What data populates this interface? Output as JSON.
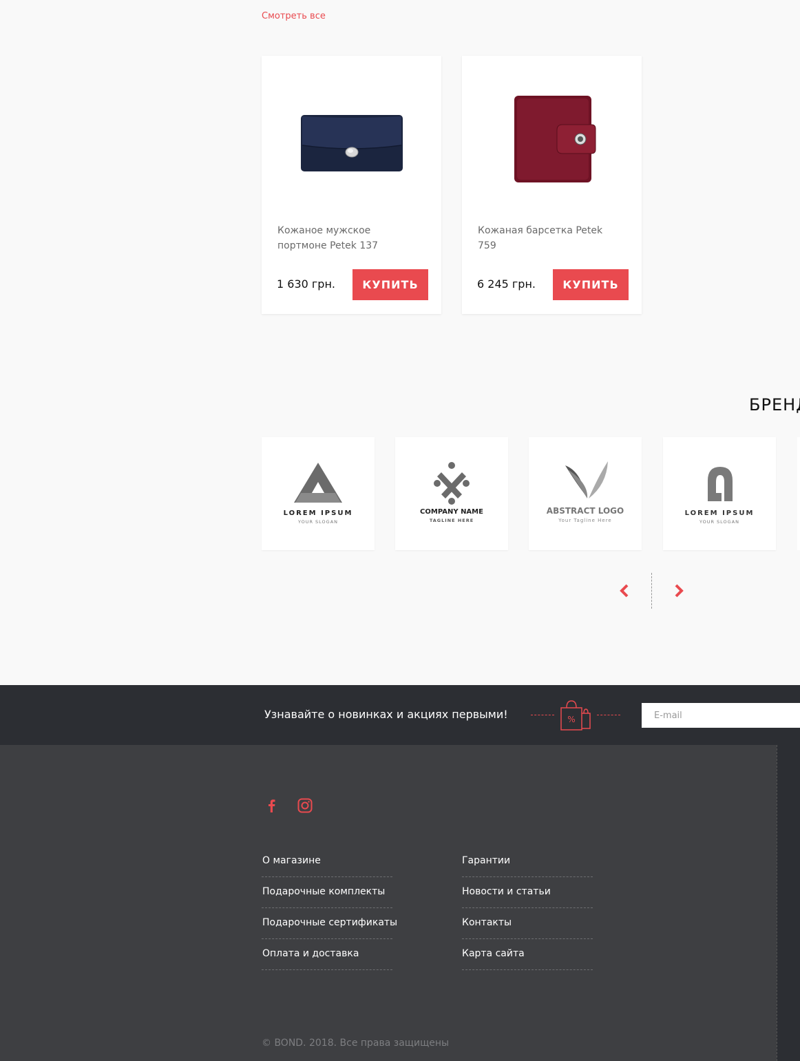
{
  "see_all": "Смотреть все",
  "products": [
    {
      "name": "Кожаное мужское портмоне Petek 137",
      "price": "1 630 грн.",
      "buy": "КУПИТЬ",
      "color": "#1f2a44"
    },
    {
      "name": "Кожаная барсетка Petek 759",
      "price": "6 245 грн.",
      "buy": "КУПИТЬ",
      "color": "#7a1628"
    }
  ],
  "brands": {
    "title": "БРЕНД",
    "logos": [
      {
        "line1": "LOREM IPSUM",
        "line2": "YOUR SLOGAN"
      },
      {
        "line1": "COMPANY NAME",
        "line2": "TAGLINE HERE"
      },
      {
        "line1": "ABSTRACT LOGO",
        "line2": "Your Tagline Here"
      },
      {
        "line1": "LOREM IPSUM",
        "line2": "YOUR SLOGAN"
      }
    ]
  },
  "subscribe": {
    "text": "Узнавайте о новинках и акциях первыми!",
    "placeholder": "E-mail",
    "icon": "shopping-bags-percent-icon"
  },
  "footer": {
    "social": [
      "facebook-icon",
      "instagram-icon"
    ],
    "links_left": [
      "О магазине",
      "Подарочные комплекты",
      "Подарочные сертификаты",
      "Оплата и доставка"
    ],
    "links_right": [
      "Гарантии",
      "Новости и статьи",
      "Контакты",
      "Карта сайта"
    ],
    "copyright": "© BOND. 2018. Все права защищены"
  },
  "colors": {
    "accent": "#e94a4f",
    "dark": "#2c2e33",
    "footer": "#3e3f42"
  }
}
